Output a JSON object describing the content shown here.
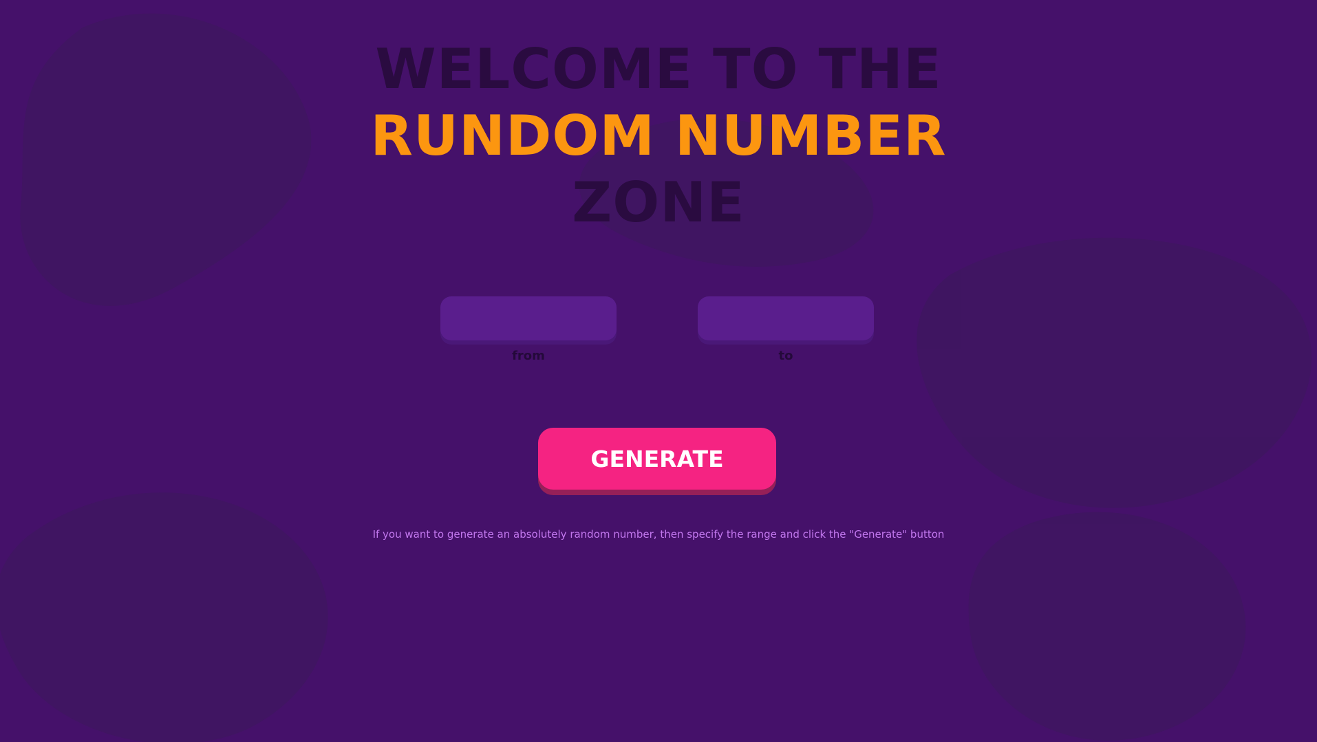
{
  "heading": {
    "line1": "WELCOME TO THE",
    "line2": "RUNDOM NUMBER",
    "line3": "ZONE"
  },
  "inputs": {
    "from": {
      "value": "",
      "label": "from"
    },
    "to": {
      "value": "",
      "label": "to"
    }
  },
  "generate_button": {
    "label": "GENERATE"
  },
  "hint": "If you want to generate an absolutely random number, then specify the range and click the \"Generate\" button",
  "colors": {
    "background": "#45116a",
    "heading_dark": "#2a0b40",
    "heading_accent": "#fc9610",
    "input_fill": "#5a1e8d",
    "button": "#f52382",
    "hint_text": "#c277ee"
  }
}
